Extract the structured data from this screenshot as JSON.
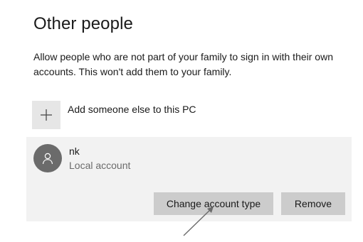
{
  "page": {
    "title": "Other people",
    "description": "Allow people who are not part of your family to sign in with their own accounts. This won't add them to your family."
  },
  "add_user": {
    "label": "Add someone else to this PC",
    "icon": "plus-icon"
  },
  "account": {
    "name": "nk",
    "type": "Local account",
    "avatar_icon": "person-icon",
    "change_type_label": "Change account type",
    "remove_label": "Remove"
  },
  "colors": {
    "card_bg": "#f2f2f2",
    "tile_bg": "#e6e6e6",
    "button_bg": "#cccccc",
    "avatar_bg": "#6b6b6b",
    "secondary_text": "#6b6b6b"
  }
}
